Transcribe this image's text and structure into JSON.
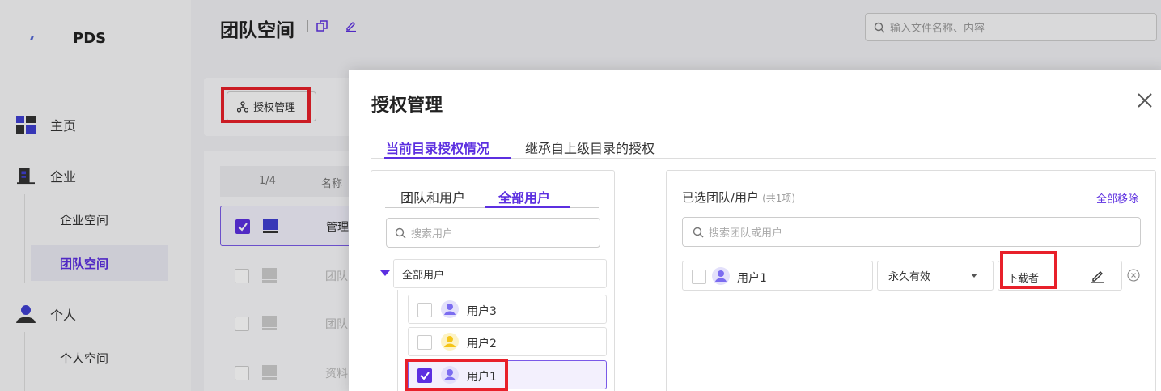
{
  "app": {
    "logo_text": "PDS"
  },
  "sidebar": {
    "home": "主页",
    "enterprise": "企业",
    "enterprise_space": "企业空间",
    "team_space": "团队空间",
    "personal": "个人",
    "personal_space": "个人空间"
  },
  "header": {
    "title": "团队空间",
    "search_placeholder": "输入文件名称、内容"
  },
  "toolbar": {
    "auth_button": "授权管理"
  },
  "table": {
    "page": "1/4",
    "col_name": "名称",
    "rows": [
      "管理",
      "团队",
      "团队",
      "资料"
    ]
  },
  "modal": {
    "title": "授权管理",
    "tabs": [
      "当前目录授权情况",
      "继承自上级目录的授权"
    ],
    "left": {
      "sub_tabs": [
        "团队和用户",
        "全部用户"
      ],
      "search_placeholder": "搜索用户",
      "root": "全部用户",
      "users": [
        {
          "name": "用户3",
          "checked": false,
          "avatar_color": "#7b6cf0"
        },
        {
          "name": "用户2",
          "checked": false,
          "avatar_color": "#f5c518"
        },
        {
          "name": "用户1",
          "checked": true,
          "avatar_color": "#7b6cf0"
        }
      ]
    },
    "right": {
      "title": "已选团队/用户",
      "count": "(共1项)",
      "remove_all": "全部移除",
      "search_placeholder": "搜索团队或用户",
      "selected_user": "用户1",
      "validity": "永久有效",
      "role": "下载者"
    }
  },
  "colors": {
    "accent": "#5c2fe0",
    "highlight": "#e8202a"
  }
}
